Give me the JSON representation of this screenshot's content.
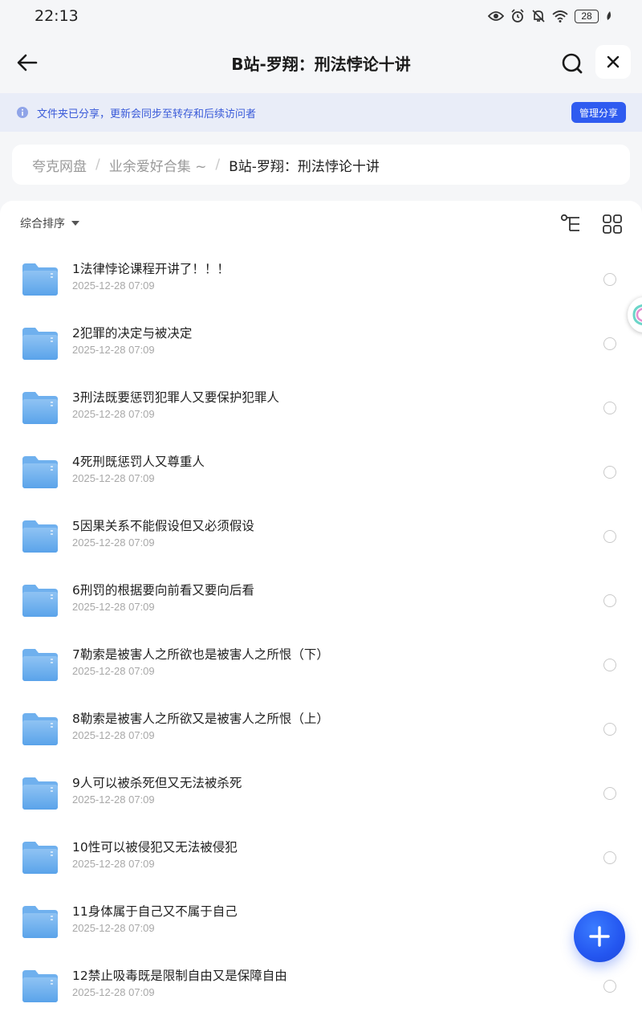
{
  "status_bar": {
    "time": "22:13",
    "battery": "28",
    "icons": [
      "eye-icon",
      "alarm-icon",
      "mute-icon",
      "wifi-icon",
      "battery-icon",
      "leaf-icon"
    ]
  },
  "header": {
    "title": "B站-罗翔：刑法悖论十讲",
    "back_icon": "arrow-left-icon",
    "search_icon": "search-icon",
    "close_icon": "close-icon"
  },
  "notice": {
    "text": "文件夹已分享，更新会同步至转存和后续访问者",
    "button": "管理分享",
    "accent_color": "#2f5bf0"
  },
  "breadcrumb": {
    "root": "夸克网盘",
    "parent": "业余爱好合集 ~",
    "current": "B站-罗翔：刑法悖论十讲",
    "separator": "/"
  },
  "toolbar": {
    "sort_label": "综合排序"
  },
  "files": [
    {
      "name": "1法律悖论课程开讲了！！！",
      "date": "2025-12-28 07:09"
    },
    {
      "name": "2犯罪的决定与被决定",
      "date": "2025-12-28 07:09"
    },
    {
      "name": "3刑法既要惩罚犯罪人又要保护犯罪人",
      "date": "2025-12-28 07:09"
    },
    {
      "name": "4死刑既惩罚人又尊重人",
      "date": "2025-12-28 07:09"
    },
    {
      "name": "5因果关系不能假设但又必须假设",
      "date": "2025-12-28 07:09"
    },
    {
      "name": "6刑罚的根据要向前看又要向后看",
      "date": "2025-12-28 07:09"
    },
    {
      "name": "7勒索是被害人之所欲也是被害人之所恨（下）",
      "date": "2025-12-28 07:09"
    },
    {
      "name": "8勒索是被害人之所欲又是被害人之所恨（上）",
      "date": "2025-12-28 07:09"
    },
    {
      "name": "9人可以被杀死但又无法被杀死",
      "date": "2025-12-28 07:09"
    },
    {
      "name": "10性可以被侵犯又无法被侵犯",
      "date": "2025-12-28 07:09"
    },
    {
      "name": "11身体属于自己又不属于自己",
      "date": "2025-12-28 07:09"
    },
    {
      "name": "12禁止吸毒既是限制自由又是保障自由",
      "date": "2025-12-28 07:09"
    }
  ]
}
